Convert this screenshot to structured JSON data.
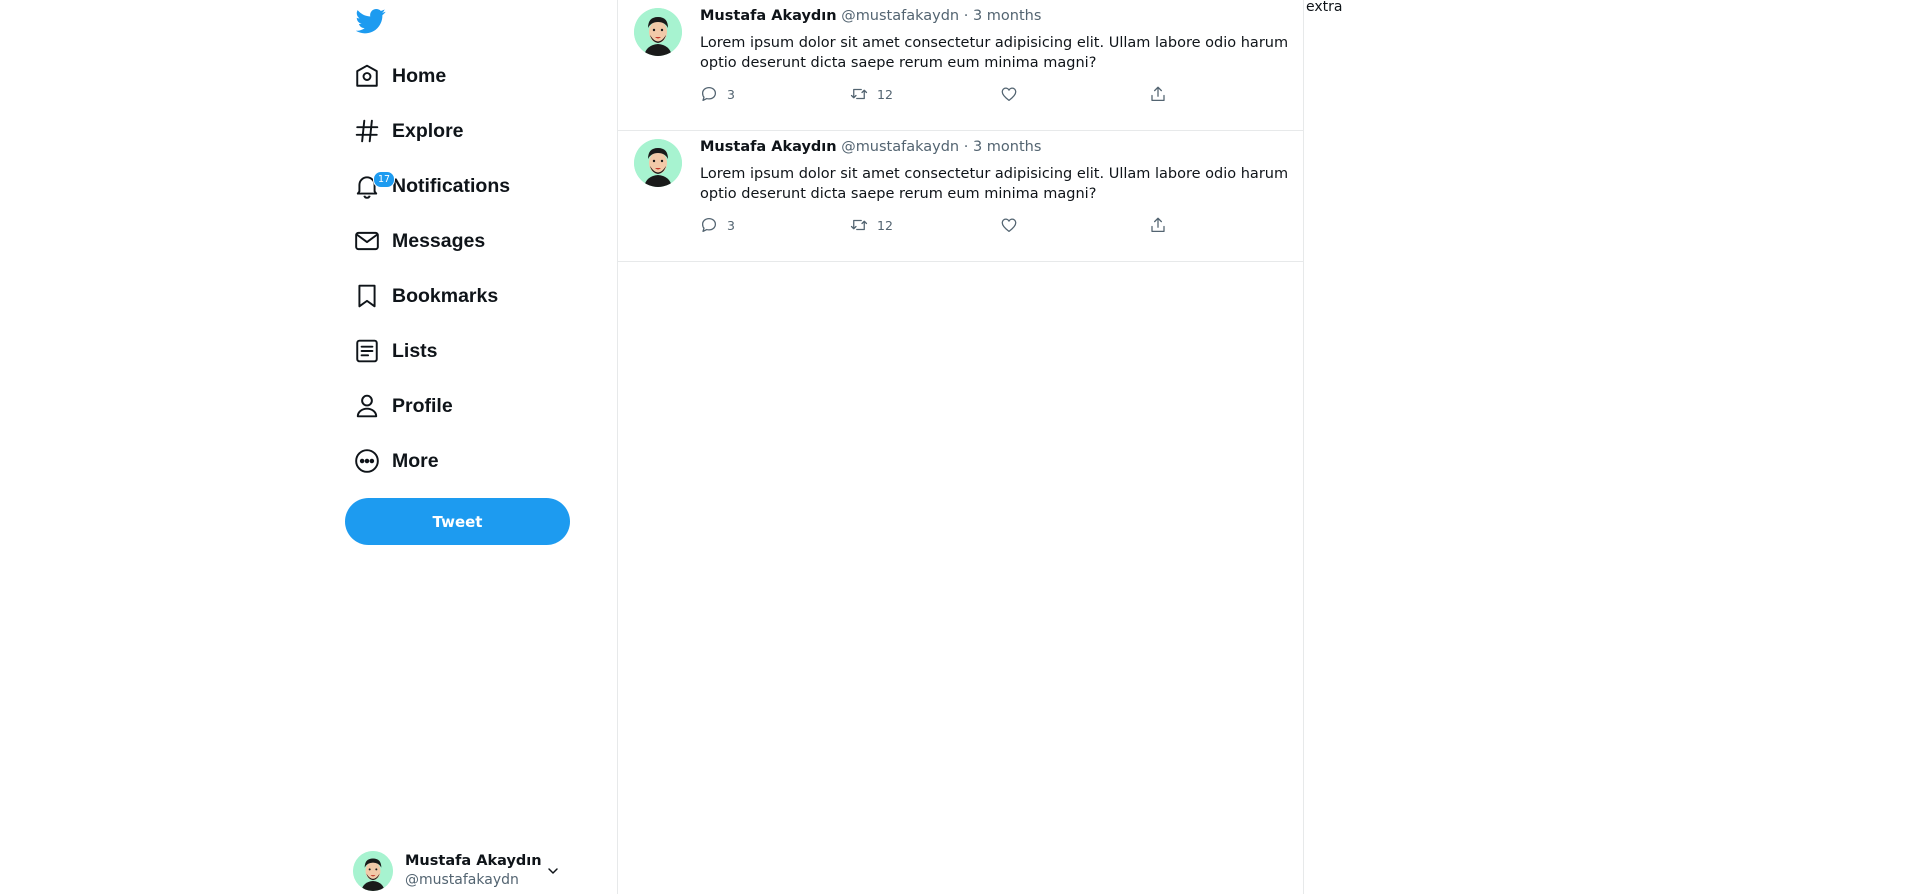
{
  "nav": {
    "items": [
      {
        "label": "Home",
        "icon": "home-icon"
      },
      {
        "label": "Explore",
        "icon": "hashtag-icon"
      },
      {
        "label": "Notifications",
        "icon": "bell-icon",
        "badge": "17"
      },
      {
        "label": "Messages",
        "icon": "envelope-icon"
      },
      {
        "label": "Bookmarks",
        "icon": "bookmark-icon"
      },
      {
        "label": "Lists",
        "icon": "list-icon"
      },
      {
        "label": "Profile",
        "icon": "user-icon"
      },
      {
        "label": "More",
        "icon": "more-icon"
      }
    ],
    "tweet_button": "Tweet"
  },
  "account": {
    "name": "Mustafa Akaydın",
    "handle": "@mustafakaydn"
  },
  "tweets": [
    {
      "name": "Mustafa Akaydın",
      "handle": "@mustafakaydn",
      "dot": "·",
      "time": "3 months",
      "text": "Lorem ipsum dolor sit amet consectetur adipisicing elit. Ullam labore odio harum optio deserunt dicta saepe rerum eum minima magni?",
      "replies": "3",
      "retweets": "12"
    },
    {
      "name": "Mustafa Akaydın",
      "handle": "@mustafakaydn",
      "dot": "·",
      "time": "3 months",
      "text": "Lorem ipsum dolor sit amet consectetur adipisicing elit. Ullam labore odio harum optio deserunt dicta saepe rerum eum minima magni?",
      "replies": "3",
      "retweets": "12"
    }
  ],
  "extra": {
    "label": "extra"
  },
  "colors": {
    "accent": "#1d9bf0",
    "avatar_bg": "#a7f3d0",
    "muted": "#536471"
  }
}
